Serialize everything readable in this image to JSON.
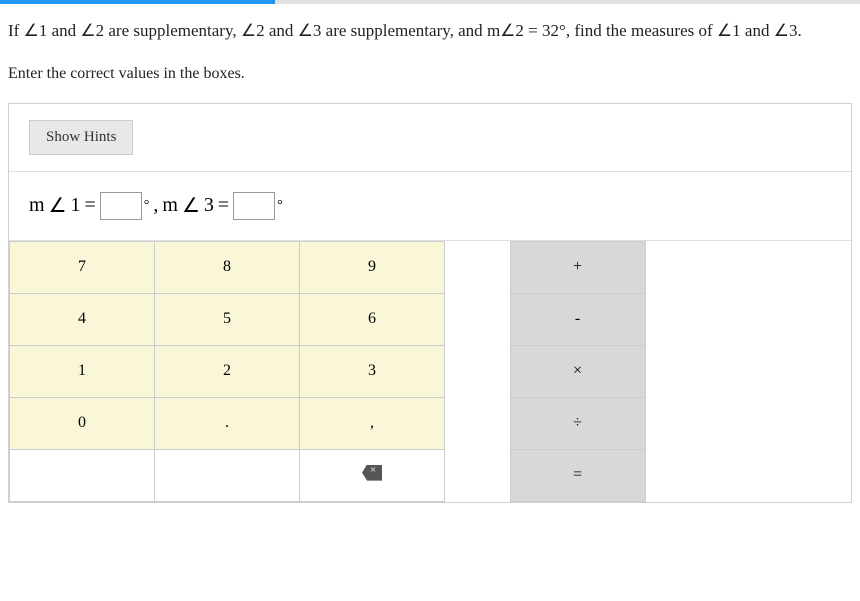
{
  "question": {
    "prefix": "If ",
    "angle_sym": "∠",
    "a1": "1",
    "and1": " and ",
    "a2": "2",
    "supp1": " are supplementary, ",
    "a2b": "2",
    "and2": " and ",
    "a3": "3",
    "supp2": " are supplementary, and ",
    "measure_prefix": "m",
    "a2c": "2",
    "eq": " = ",
    "value": "32",
    "deg": "°",
    "find": ", find the measures of ",
    "a1b": "1",
    "and3": " and ",
    "a3b": "3",
    "period": "."
  },
  "instruction": "Enter the correct values in the boxes.",
  "hints_label": "Show Hints",
  "answer": {
    "m": "m",
    "angle": "∠",
    "one": "1",
    "eq": " = ",
    "deg": "°",
    "comma": ", ",
    "three": "3"
  },
  "keypad": {
    "r1": [
      "7",
      "8",
      "9"
    ],
    "r2": [
      "4",
      "5",
      "6"
    ],
    "r3": [
      "1",
      "2",
      "3"
    ],
    "r4": [
      "0",
      ".",
      ","
    ],
    "ops": [
      "+",
      "-",
      "×",
      "÷",
      "="
    ]
  }
}
